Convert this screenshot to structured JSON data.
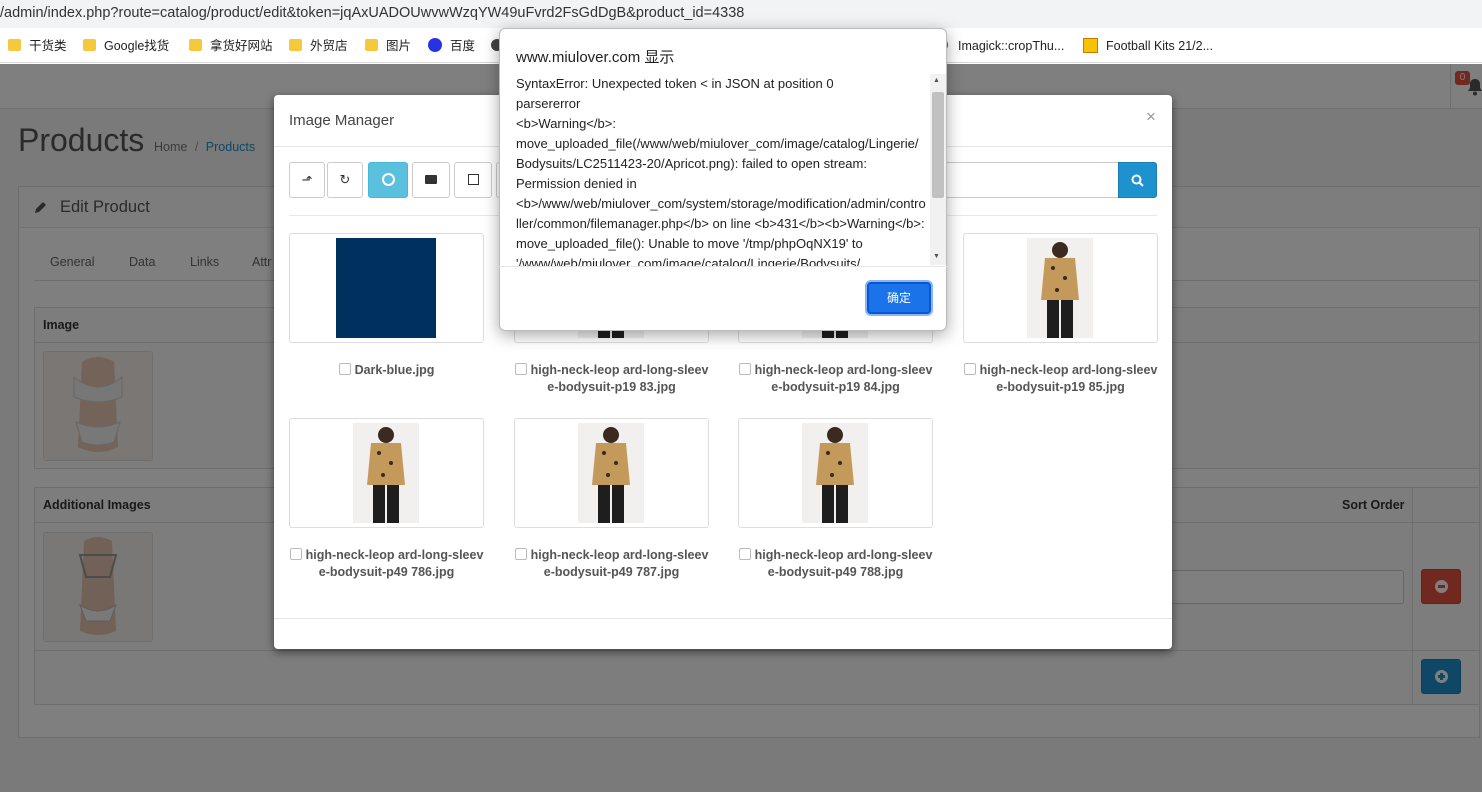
{
  "browser": {
    "url": "/admin/index.php?route=catalog/product/edit&token=jqAxUADOUwvwWzqYW49uFvrd2FsGdDgB&product_id=4338",
    "bookmarks": [
      {
        "label": "干货类",
        "icon": "folder-icon"
      },
      {
        "label": "Google找货",
        "icon": "folder-icon"
      },
      {
        "label": "拿货好网站",
        "icon": "folder-icon"
      },
      {
        "label": "外贸店",
        "icon": "folder-icon"
      },
      {
        "label": "图片",
        "icon": "folder-icon"
      },
      {
        "label": "百度",
        "icon": "baidu-paw-icon"
      },
      {
        "label": "Imagick::cropThu...",
        "icon": "site-icon"
      },
      {
        "label": "Football Kits 21/2...",
        "icon": "site-icon"
      }
    ]
  },
  "header": {
    "notification_count": "0"
  },
  "page": {
    "title": "Products",
    "breadcrumb": {
      "home": "Home",
      "separator": "/",
      "current": "Products"
    },
    "panel_title": "Edit Product",
    "tabs": [
      "General",
      "Data",
      "Links",
      "Attr"
    ],
    "image_section": {
      "header": "Image"
    },
    "additional_images": {
      "header": "Additional Images",
      "sort_order_header": "Sort Order"
    }
  },
  "image_manager": {
    "title": "Image Manager",
    "close": "×",
    "toolbar_icons": [
      "level-up-icon",
      "refresh-icon",
      "upload-icon",
      "folder-icon",
      "image-icon"
    ],
    "files": [
      {
        "name": "Dark-blue.jpg",
        "kind": "swatch",
        "color": "#00305e"
      },
      {
        "name": "high-neck-leop ard-long-sleev e-bodysuit-p19 83.jpg",
        "kind": "photo"
      },
      {
        "name": "high-neck-leop ard-long-sleev e-bodysuit-p19 84.jpg",
        "kind": "photo"
      },
      {
        "name": "high-neck-leop ard-long-sleev e-bodysuit-p19 85.jpg",
        "kind": "photo"
      },
      {
        "name": "high-neck-leop ard-long-sleev e-bodysuit-p49 786.jpg",
        "kind": "photo"
      },
      {
        "name": "high-neck-leop ard-long-sleev e-bodysuit-p49 787.jpg",
        "kind": "photo"
      },
      {
        "name": "high-neck-leop ard-long-sleev e-bodysuit-p49 788.jpg",
        "kind": "photo"
      }
    ]
  },
  "alert": {
    "title": "www.miulover.com 显示",
    "message": "SyntaxError: Unexpected token < in JSON at position 0\nparsererror\n<b>Warning</b>: move_uploaded_file(/www/web/miulover_com/image/catalog/Lingerie/Bodysuits/LC2511423-20/Apricot.png): failed to open stream: Permission denied in <b>/www/web/miulover_com/system/storage/modification/admin/controller/common/filemanager.php</b> on line <b>431</b><b>Warning</b>: move_uploaded_file(): Unable to move '/tmp/phpOqNX19' to '/www/web/miulover_com/image/catalog/Lingerie/Bodysuits/",
    "ok_label": "确定"
  },
  "colors": {
    "primary": "#1e91cf",
    "danger": "#e3503e",
    "dialog_button": "#1a73e8"
  }
}
